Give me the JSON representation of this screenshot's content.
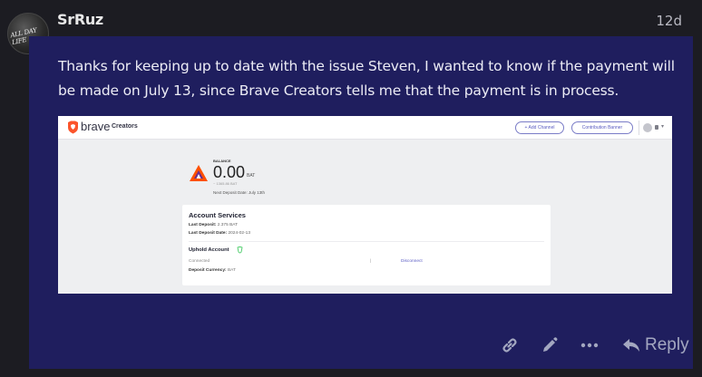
{
  "post": {
    "username": "SrRuz",
    "date": "12d",
    "avatar_text": "ALL DAY LIFE",
    "text": "Thanks for keeping up to date with the issue Steven, I wanted to know if the payment will be made on July 13, since Brave Creators tells me that the payment is in process."
  },
  "screenshot": {
    "brand": "brave",
    "brand_sub": "Creators",
    "add_channel": "+ Add Channel",
    "contribution_banner": "Contribution Banner",
    "balance_label": "BALANCE",
    "balance_amount": "0.00",
    "balance_unit": "BAT",
    "balance_usd": "~ 1365.86 BAT",
    "next_deposit": "Next Deposit Date: July 13th",
    "services_title": "Account Services",
    "last_deposit_label": "Last Deposit:",
    "last_deposit_value": "2.375 BAT",
    "last_deposit_date_label": "Last Deposit Date:",
    "last_deposit_date_value": "2024-02-13",
    "uphold_title": "Uphold Account",
    "uphold_status": "Connected",
    "uphold_pipe": "|",
    "uphold_disconnect": "Disconnect",
    "deposit_currency_label": "Deposit Currency:",
    "deposit_currency_value": "BAT"
  },
  "actions": {
    "reply_label": "Reply"
  },
  "icons": {
    "link": "link-icon",
    "edit": "pencil-icon",
    "more": "ellipsis-icon",
    "reply": "reply-arrow-icon"
  },
  "colors": {
    "post_bg": "#1f1e5e",
    "page_bg": "#1c1c22",
    "action_color": "#a3a7c0",
    "brave_orange": "#fb542b"
  }
}
